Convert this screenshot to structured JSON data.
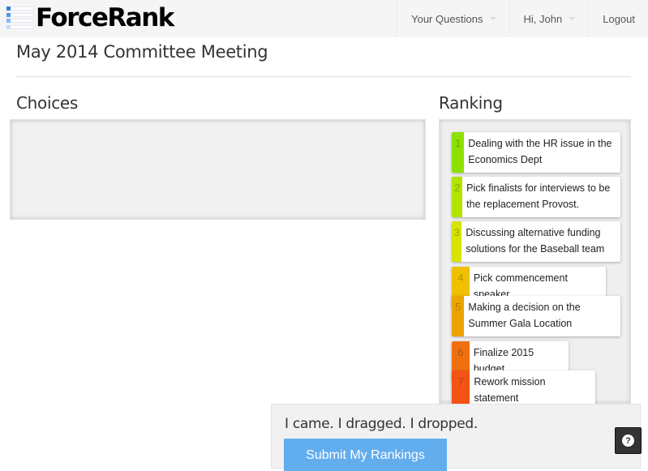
{
  "brand": {
    "name": "ForceRank"
  },
  "nav": {
    "items": [
      {
        "label": "Your Questions",
        "dropdown": true
      },
      {
        "label": "Hi, John",
        "dropdown": true
      },
      {
        "label": "Logout",
        "dropdown": false
      }
    ]
  },
  "page": {
    "title": "May 2014 Committee Meeting"
  },
  "choices": {
    "heading": "Choices",
    "items": []
  },
  "ranking": {
    "heading": "Ranking",
    "items": [
      {
        "rank": "1",
        "label": "Dealing with the HR issue in the Economics Dept",
        "color": "#8ee000"
      },
      {
        "rank": "2",
        "label": "Pick finalists for interviews to be the replacement Provost.",
        "color": "#b4e300"
      },
      {
        "rank": "3",
        "label": "Discussing alternative funding solutions for the Baseball team",
        "color": "#d6e400"
      },
      {
        "rank": "4",
        "label": "Pick commencement speaker",
        "color": "#eec000"
      },
      {
        "rank": "5",
        "label": "Making a decision on the Summer Gala Location",
        "color": "#eca400"
      },
      {
        "rank": "6",
        "label": "Finalize 2015 budget",
        "color": "#f07010"
      },
      {
        "rank": "7",
        "label": "Rework mission statement",
        "color": "#f45314"
      }
    ]
  },
  "footer": {
    "tagline": "I came. I dragged. I dropped.",
    "submit_label": "Submit My Rankings"
  },
  "help": {
    "icon": "question-icon",
    "label": "?"
  }
}
